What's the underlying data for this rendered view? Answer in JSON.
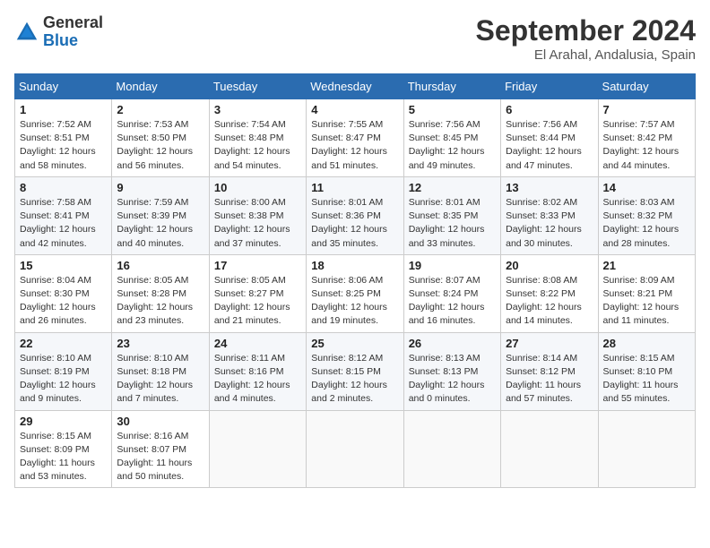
{
  "header": {
    "logo_text_general": "General",
    "logo_text_blue": "Blue",
    "month_year": "September 2024",
    "location": "El Arahal, Andalusia, Spain"
  },
  "weekdays": [
    "Sunday",
    "Monday",
    "Tuesday",
    "Wednesday",
    "Thursday",
    "Friday",
    "Saturday"
  ],
  "weeks": [
    [
      {
        "day": "1",
        "sunrise": "7:52 AM",
        "sunset": "8:51 PM",
        "daylight": "12 hours and 58 minutes."
      },
      {
        "day": "2",
        "sunrise": "7:53 AM",
        "sunset": "8:50 PM",
        "daylight": "12 hours and 56 minutes."
      },
      {
        "day": "3",
        "sunrise": "7:54 AM",
        "sunset": "8:48 PM",
        "daylight": "12 hours and 54 minutes."
      },
      {
        "day": "4",
        "sunrise": "7:55 AM",
        "sunset": "8:47 PM",
        "daylight": "12 hours and 51 minutes."
      },
      {
        "day": "5",
        "sunrise": "7:56 AM",
        "sunset": "8:45 PM",
        "daylight": "12 hours and 49 minutes."
      },
      {
        "day": "6",
        "sunrise": "7:56 AM",
        "sunset": "8:44 PM",
        "daylight": "12 hours and 47 minutes."
      },
      {
        "day": "7",
        "sunrise": "7:57 AM",
        "sunset": "8:42 PM",
        "daylight": "12 hours and 44 minutes."
      }
    ],
    [
      {
        "day": "8",
        "sunrise": "7:58 AM",
        "sunset": "8:41 PM",
        "daylight": "12 hours and 42 minutes."
      },
      {
        "day": "9",
        "sunrise": "7:59 AM",
        "sunset": "8:39 PM",
        "daylight": "12 hours and 40 minutes."
      },
      {
        "day": "10",
        "sunrise": "8:00 AM",
        "sunset": "8:38 PM",
        "daylight": "12 hours and 37 minutes."
      },
      {
        "day": "11",
        "sunrise": "8:01 AM",
        "sunset": "8:36 PM",
        "daylight": "12 hours and 35 minutes."
      },
      {
        "day": "12",
        "sunrise": "8:01 AM",
        "sunset": "8:35 PM",
        "daylight": "12 hours and 33 minutes."
      },
      {
        "day": "13",
        "sunrise": "8:02 AM",
        "sunset": "8:33 PM",
        "daylight": "12 hours and 30 minutes."
      },
      {
        "day": "14",
        "sunrise": "8:03 AM",
        "sunset": "8:32 PM",
        "daylight": "12 hours and 28 minutes."
      }
    ],
    [
      {
        "day": "15",
        "sunrise": "8:04 AM",
        "sunset": "8:30 PM",
        "daylight": "12 hours and 26 minutes."
      },
      {
        "day": "16",
        "sunrise": "8:05 AM",
        "sunset": "8:28 PM",
        "daylight": "12 hours and 23 minutes."
      },
      {
        "day": "17",
        "sunrise": "8:05 AM",
        "sunset": "8:27 PM",
        "daylight": "12 hours and 21 minutes."
      },
      {
        "day": "18",
        "sunrise": "8:06 AM",
        "sunset": "8:25 PM",
        "daylight": "12 hours and 19 minutes."
      },
      {
        "day": "19",
        "sunrise": "8:07 AM",
        "sunset": "8:24 PM",
        "daylight": "12 hours and 16 minutes."
      },
      {
        "day": "20",
        "sunrise": "8:08 AM",
        "sunset": "8:22 PM",
        "daylight": "12 hours and 14 minutes."
      },
      {
        "day": "21",
        "sunrise": "8:09 AM",
        "sunset": "8:21 PM",
        "daylight": "12 hours and 11 minutes."
      }
    ],
    [
      {
        "day": "22",
        "sunrise": "8:10 AM",
        "sunset": "8:19 PM",
        "daylight": "12 hours and 9 minutes."
      },
      {
        "day": "23",
        "sunrise": "8:10 AM",
        "sunset": "8:18 PM",
        "daylight": "12 hours and 7 minutes."
      },
      {
        "day": "24",
        "sunrise": "8:11 AM",
        "sunset": "8:16 PM",
        "daylight": "12 hours and 4 minutes."
      },
      {
        "day": "25",
        "sunrise": "8:12 AM",
        "sunset": "8:15 PM",
        "daylight": "12 hours and 2 minutes."
      },
      {
        "day": "26",
        "sunrise": "8:13 AM",
        "sunset": "8:13 PM",
        "daylight": "12 hours and 0 minutes."
      },
      {
        "day": "27",
        "sunrise": "8:14 AM",
        "sunset": "8:12 PM",
        "daylight": "11 hours and 57 minutes."
      },
      {
        "day": "28",
        "sunrise": "8:15 AM",
        "sunset": "8:10 PM",
        "daylight": "11 hours and 55 minutes."
      }
    ],
    [
      {
        "day": "29",
        "sunrise": "8:15 AM",
        "sunset": "8:09 PM",
        "daylight": "11 hours and 53 minutes."
      },
      {
        "day": "30",
        "sunrise": "8:16 AM",
        "sunset": "8:07 PM",
        "daylight": "11 hours and 50 minutes."
      },
      null,
      null,
      null,
      null,
      null
    ]
  ]
}
